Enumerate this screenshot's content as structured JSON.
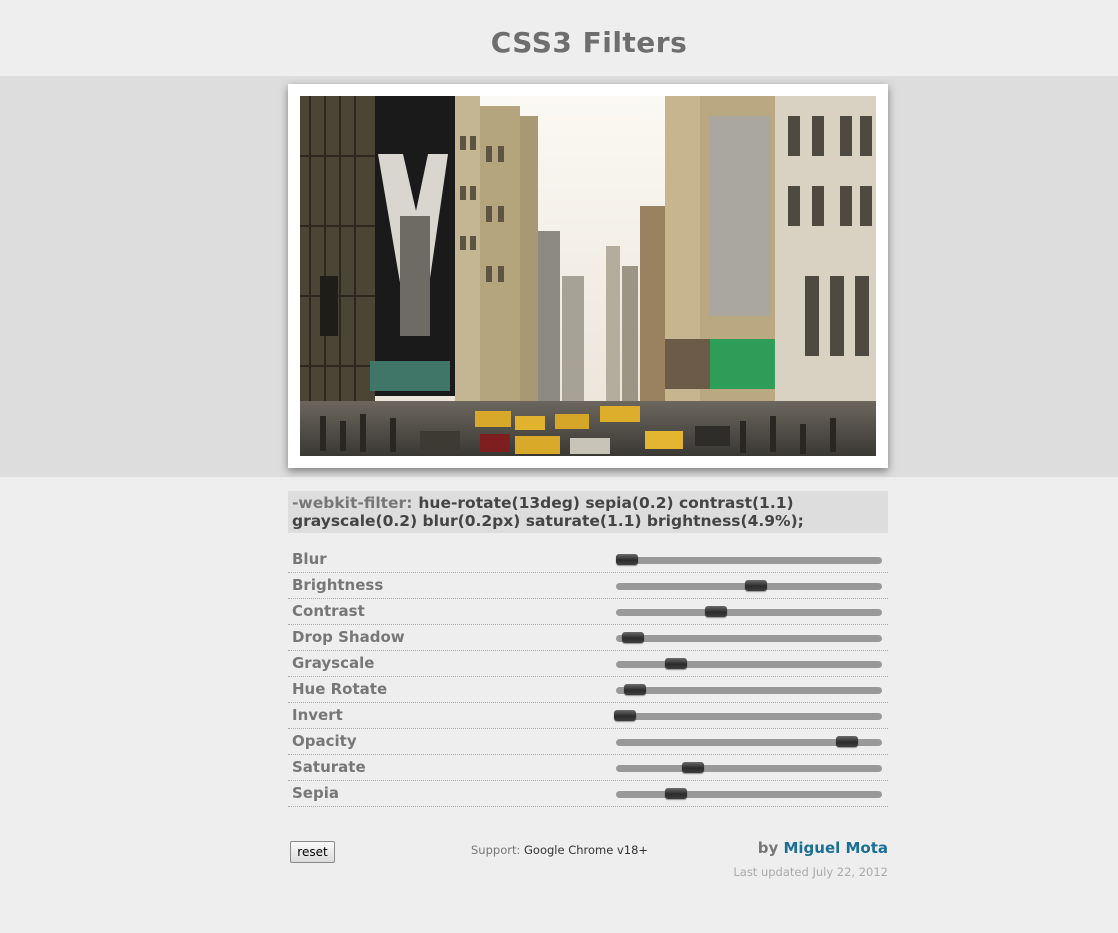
{
  "page_title": "CSS3 Filters",
  "photo": {
    "description_icon": "city-street-photo"
  },
  "filter_code": {
    "property": "-webkit-filter:",
    "value": "hue-rotate(13deg) sepia(0.2) contrast(1.1) grayscale(0.2) blur(0.2px) saturate(1.1) brightness(4.9%);"
  },
  "sliders": [
    {
      "label": "Blur",
      "value_fraction": 0.04
    },
    {
      "label": "Brightness",
      "value_fraction": 0.525
    },
    {
      "label": "Contrast",
      "value_fraction": 0.375
    },
    {
      "label": "Drop Shadow",
      "value_fraction": 0.065
    },
    {
      "label": "Grayscale",
      "value_fraction": 0.225
    },
    {
      "label": "Hue Rotate",
      "value_fraction": 0.07
    },
    {
      "label": "Invert",
      "value_fraction": 0.035
    },
    {
      "label": "Opacity",
      "value_fraction": 0.87
    },
    {
      "label": "Saturate",
      "value_fraction": 0.29
    },
    {
      "label": "Sepia",
      "value_fraction": 0.225
    }
  ],
  "footer": {
    "reset_label": "reset",
    "support_prefix": "Support:",
    "support_browser": "Google Chrome v18+",
    "by_prefix": "by",
    "author": "Miguel Mota",
    "last_updated": "Last updated July 22, 2012"
  },
  "colors": {
    "background": "#eeeeee",
    "stage": "#dddddd",
    "author_link": "#1b6f95",
    "title": "#6e6e6e"
  }
}
